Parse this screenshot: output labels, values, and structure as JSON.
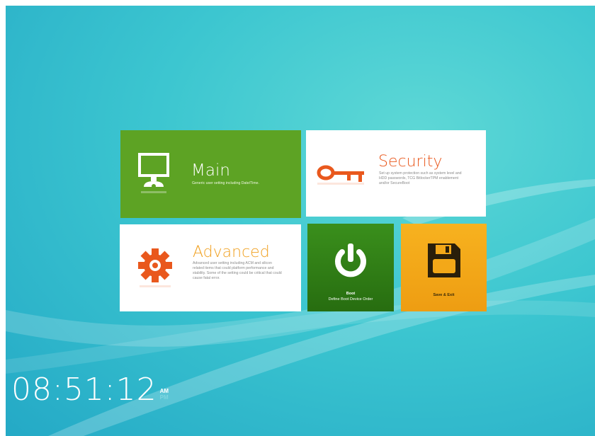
{
  "tiles": {
    "main": {
      "title": "Main",
      "description": "Generic user setting including Date/Time.",
      "icon": "monitor-icon",
      "color": "#5da324"
    },
    "security": {
      "title": "Security",
      "description": "Set up system protection such as system level and HDD passwords, TCG BitlockerTPM enablement and/or SecureBoot",
      "icon": "key-icon",
      "color": "#e9581d"
    },
    "advanced": {
      "title": "Advanced",
      "description": "Advanced user setting including ACM and silicon related items that could platform performance and stability. Some of the setting could be critical that could cause fatal error.",
      "icon": "gear-icon",
      "color": "#e9581d"
    },
    "boot": {
      "title": "Boot",
      "description": "Define Boot Device Order",
      "icon": "power-icon",
      "color": "#2e7d14"
    },
    "save_exit": {
      "title": "Save & Exit",
      "icon": "floppy-disk-icon",
      "color": "#f3a818"
    }
  },
  "clock": {
    "time": "08:51:12",
    "am": "AM",
    "pm": "PM"
  }
}
